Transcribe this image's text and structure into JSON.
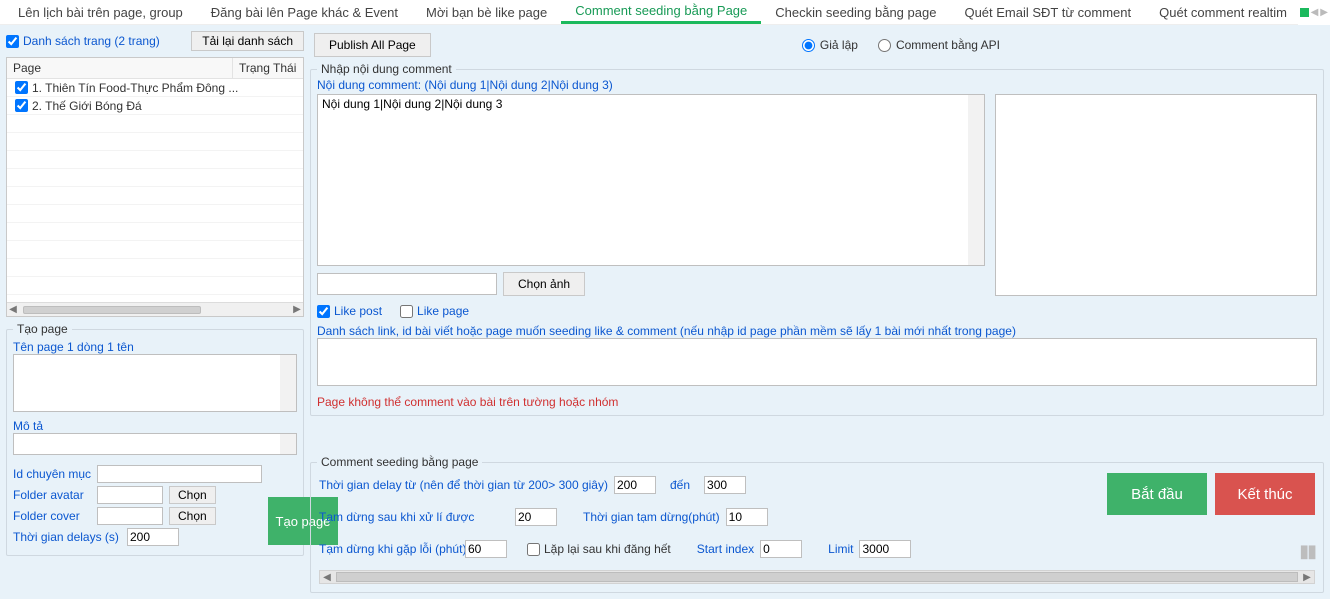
{
  "tabs": {
    "t0": "Lên lịch bài trên page, group",
    "t1": "Đăng bài lên Page khác & Event",
    "t2": "Mời bạn bè like page",
    "t3": "Comment seeding bằng Page",
    "t4": "Checkin seeding bằng page",
    "t5": "Quét Email SĐT từ comment",
    "t6": "Quét comment realtim"
  },
  "sidebar": {
    "page_list_checkbox": "Danh sách trang (2 trang)",
    "reload_button": "Tải lại danh sách",
    "col_page": "Page",
    "col_status": "Trạng Thái",
    "rows": [
      "1. Thiên Tín Food-Thực Phẩm Đông ...",
      "2. Thế Giới Bóng Đá"
    ],
    "create_group_title": "Tạo page",
    "page_name_label": "Tên page 1 dòng 1 tên",
    "desc_label": "Mô tả",
    "category_label": "Id chuyên mục",
    "folder_avatar_label": "Folder avatar",
    "folder_cover_label": "Folder cover",
    "choose_button": "Chọn",
    "delay_label": "Thời gian delays (s)",
    "delay_value": "200",
    "create_button": "Tạo page"
  },
  "toolbar": {
    "publish_button": "Publish All Page",
    "radio_fake": "Giả lập",
    "radio_api": "Comment bằng API"
  },
  "comment_group": {
    "legend": "Nhập nội dung comment",
    "content_label": "Nội dung comment: (Nội dung 1|Nội dung 2|Nội dung 3)",
    "content_value": "Nội dung 1|Nội dung 2|Nội dung 3",
    "choose_image": "Chọn ảnh",
    "like_post": "Like post",
    "like_page": "Like page",
    "link_label": "Danh sách link, id bài viết hoặc page muốn seeding like & comment (nếu nhập id page phần mềm sẽ lấy 1 bài mới nhất trong page)",
    "warn": "Page không thể comment vào bài trên tường hoặc nhóm"
  },
  "footer": {
    "legend": "Comment seeding bằng page",
    "delay_label": "Thời gian delay từ (nên để thời gian từ 200> 300 giây)",
    "delay_from": "200",
    "to_word": "đến",
    "delay_to": "300",
    "pause_after_label": "Tạm dừng sau khi xử lí được",
    "pause_after_value": "20",
    "pause_duration_label": "Thời gian tạm dừng(phút)",
    "pause_duration_value": "10",
    "pause_error_label": "Tạm dừng khi gặp lỗi (phút)",
    "pause_error_value": "60",
    "repeat_label": "Lặp lại sau khi đăng hết",
    "start_index_label": "Start index",
    "start_index_value": "0",
    "limit_label": "Limit",
    "limit_value": "3000",
    "start_button": "Bắt đầu",
    "stop_button": "Kết thúc"
  }
}
